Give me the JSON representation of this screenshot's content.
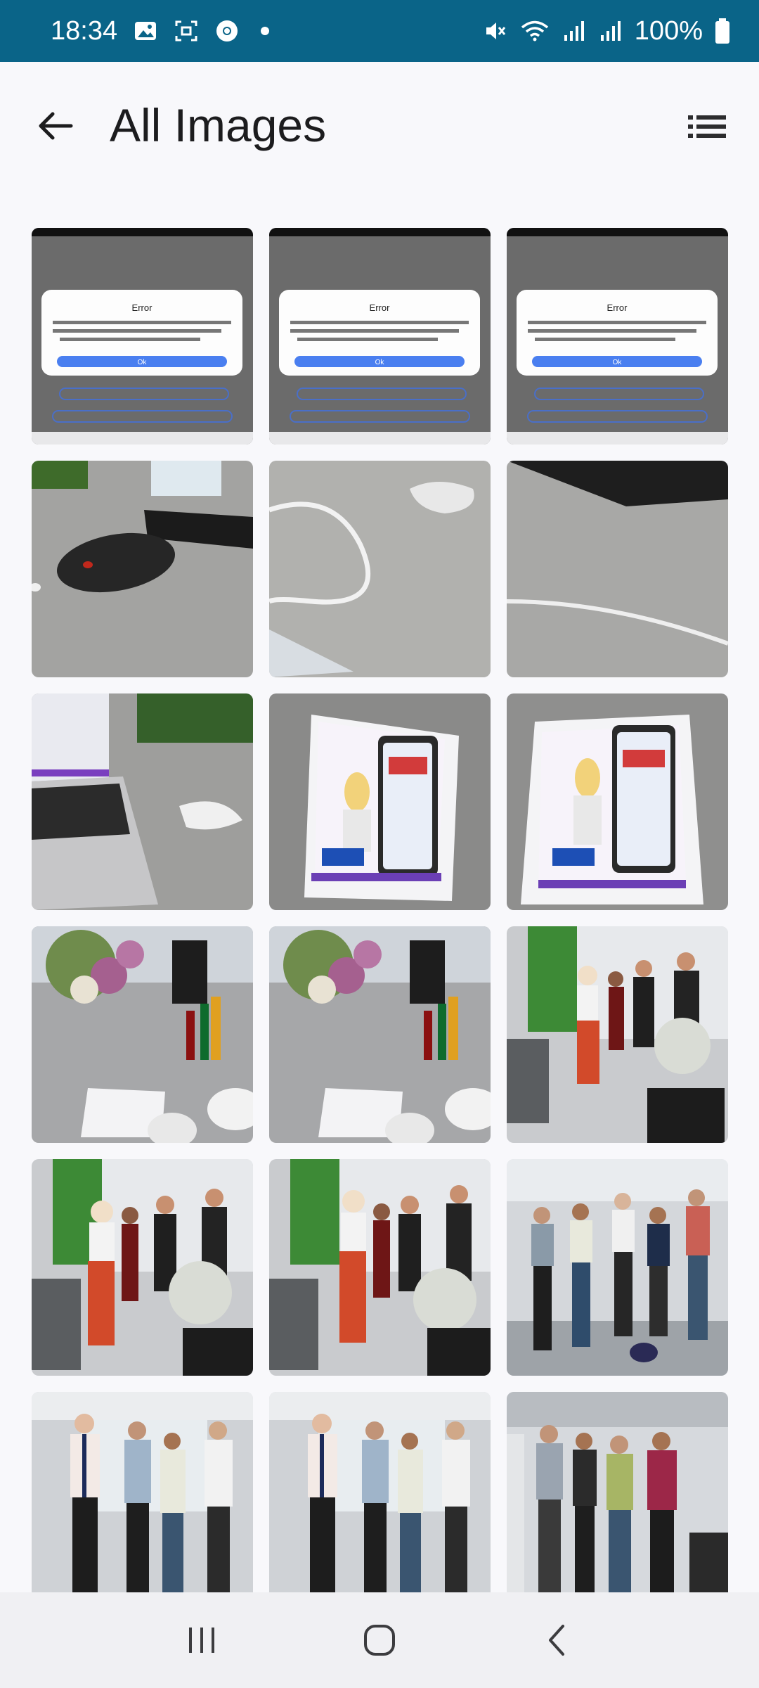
{
  "status_bar": {
    "time": "18:34",
    "battery_percent": "100%",
    "icons": [
      "gallery-icon",
      "screenshot-icon",
      "chrome-icon",
      "notification-dot",
      "mute-icon",
      "wifi-icon",
      "signal-icon",
      "signal-icon-2",
      "battery-icon"
    ]
  },
  "app_bar": {
    "title": "All Images",
    "back_icon": "arrow-left-icon",
    "menu_icon": "list-view-icon"
  },
  "gallery": {
    "columns": 3,
    "images": [
      {
        "kind": "error-dialog-screenshot",
        "dialog_title": "Error",
        "button": "Ok"
      },
      {
        "kind": "error-dialog-screenshot",
        "dialog_title": "Error",
        "button": "Ok"
      },
      {
        "kind": "error-dialog-screenshot",
        "dialog_title": "Error",
        "button": "Ok"
      },
      {
        "kind": "photo-desk-mouse"
      },
      {
        "kind": "photo-desk-cable"
      },
      {
        "kind": "photo-desk-cable-2"
      },
      {
        "kind": "photo-laptop"
      },
      {
        "kind": "photo-cake"
      },
      {
        "kind": "photo-cake-2"
      },
      {
        "kind": "photo-flowers-table"
      },
      {
        "kind": "photo-flowers-table-2"
      },
      {
        "kind": "photo-people-group"
      },
      {
        "kind": "photo-people-group-2"
      },
      {
        "kind": "photo-people-group-3"
      },
      {
        "kind": "photo-men-standing"
      },
      {
        "kind": "photo-men-office"
      },
      {
        "kind": "photo-men-office-2"
      },
      {
        "kind": "photo-men-masks"
      }
    ]
  },
  "nav_bar": {
    "icons": [
      "recent-apps-icon",
      "home-icon",
      "back-icon"
    ]
  }
}
